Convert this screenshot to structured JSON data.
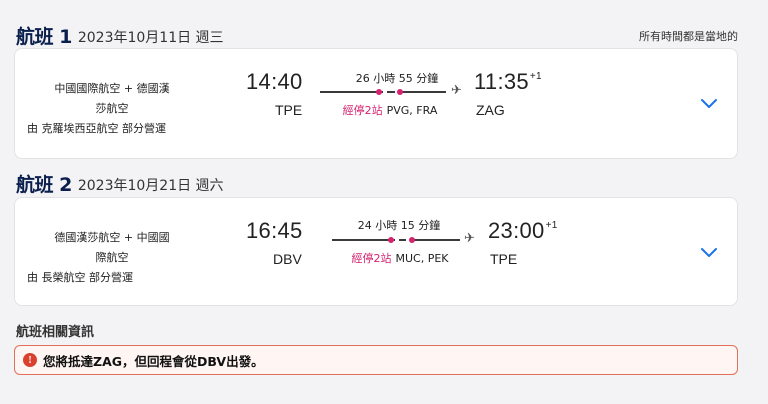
{
  "tz_note": "所有時間都是當地的",
  "flights": [
    {
      "number": "航班 1",
      "date": "2023年10月11日 週三",
      "airline_line1": "中國國際航空 + 德國漢",
      "airline_line2": "莎航空",
      "operated_by": "由 克羅埃西亞航空 部分營運",
      "dep_time": "14:40",
      "dep_code": "TPE",
      "duration": "26 小時 55 分鐘",
      "stops_count": "經停2站",
      "stops_airports": "PVG, FRA",
      "arr_time": "11:35",
      "arr_offset": "+1",
      "arr_code": "ZAG",
      "expand_icon": "chevron-down-icon"
    },
    {
      "number": "航班 2",
      "date": "2023年10月21日 週六",
      "airline_line1": "德國漢莎航空 + 中國國",
      "airline_line2": "際航空",
      "operated_by": "由 長榮航空 部分營運",
      "dep_time": "16:45",
      "dep_code": "DBV",
      "duration": "24 小時 15 分鐘",
      "stops_count": "經停2站",
      "stops_airports": "MUC, PEK",
      "arr_time": "23:00",
      "arr_offset": "+1",
      "arr_code": "TPE",
      "expand_icon": "chevron-down-icon"
    }
  ],
  "info_title": "航班相關資訊",
  "alert": {
    "icon": "!",
    "message": "您將抵達ZAG，但回程會從DBV出發。"
  },
  "colors": {
    "accent_blue": "#1a73e8",
    "stop_pink": "#d6226f",
    "alert_border": "#e0715a",
    "alert_icon": "#d9412f"
  }
}
